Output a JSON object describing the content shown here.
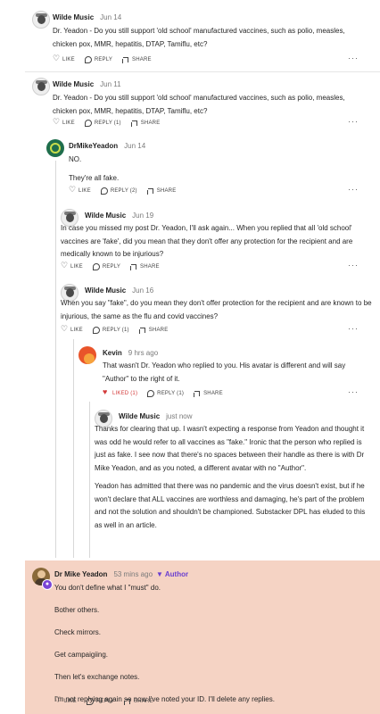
{
  "actions": {
    "like": "LIKE",
    "liked": "LIKED (1)",
    "reply": "REPLY",
    "reply_1": "REPLY (1)",
    "reply_2": "REPLY (2)",
    "share": "SHARE",
    "more": "···"
  },
  "comments": [
    {
      "author": "Wilde Music",
      "date": "Jun 14",
      "avatar_icon": "wilde-music-avatar",
      "text": "Dr. Yeadon - Do you still support 'old school' manufactured vaccines, such as polio, measles, chicken pox, MMR, hepatitis, DTAP, Tamiflu, etc?"
    },
    {
      "author": "Wilde Music",
      "date": "Jun 11",
      "avatar_icon": "wilde-music-avatar",
      "text": "Dr. Yeadon - Do you still support 'old school' manufactured vaccines, such as polio, measles, chicken pox, MMR, hepatitis, DTAP, Tamiflu, etc?"
    },
    {
      "author": "DrMikeYeadon",
      "date": "Jun 14",
      "avatar_icon": "dr-mike-yeadon-avatar",
      "paragraphs": [
        "NO.",
        "They're all fake."
      ]
    },
    {
      "author": "Wilde Music",
      "date": "Jun 19",
      "avatar_icon": "wilde-music-avatar",
      "text": "In case you missed my post Dr. Yeadon, I'll ask again... When you replied that all 'old school' vaccines are 'fake', did you mean that they don't offer any protection for the recipient and are medically known to be injurious?"
    },
    {
      "author": "Wilde Music",
      "date": "Jun 16",
      "avatar_icon": "wilde-music-avatar",
      "text": "When you say \"fake\", do you mean they don't offer protection for the recipient and are known to be injurious, the same as the flu and covid vaccines?"
    },
    {
      "author": "Kevin",
      "date": "9 hrs ago",
      "avatar_icon": "kevin-avatar",
      "text": "That wasn't Dr. Yeadon who replied to you. His avatar is different and will say \"Author\" to the right of it."
    },
    {
      "author": "Wilde Music",
      "date": "just now",
      "avatar_icon": "wilde-music-avatar",
      "paragraphs": [
        "Thanks for clearing that up. I wasn't expecting a response from Yeadon and thought it was odd he would refer to all vaccines as \"fake.\" Ironic that the person who replied is just as fake. I see now that there's no spaces between their handle as there is with Dr Mike Yeadon, and as you noted, a different avatar with no \"Author\".",
        "Yeadon has admitted that there was no pandemic and the virus doesn't exist, but if he won't declare that ALL vaccines are worthless and damaging, he's part of the problem and not the solution and shouldn't be championed. Substacker DPL has eluded to this as well in an article."
      ]
    },
    {
      "author": "Dr Mike Yeadon",
      "date": "53 mins ago",
      "author_tag": "Author",
      "avatar_icon": "dr-mike-yeadon-author-avatar",
      "badge_icon": "lightbulb-badge-icon",
      "paragraphs": [
        "You don't define what I \"must\" do.",
        "Bother others.",
        "Check mirrors.",
        "Get campaigiing.",
        "Then let's exchange notes.",
        "I'm not replying again so now I've noted your ID. I'll delete any replies."
      ]
    }
  ]
}
